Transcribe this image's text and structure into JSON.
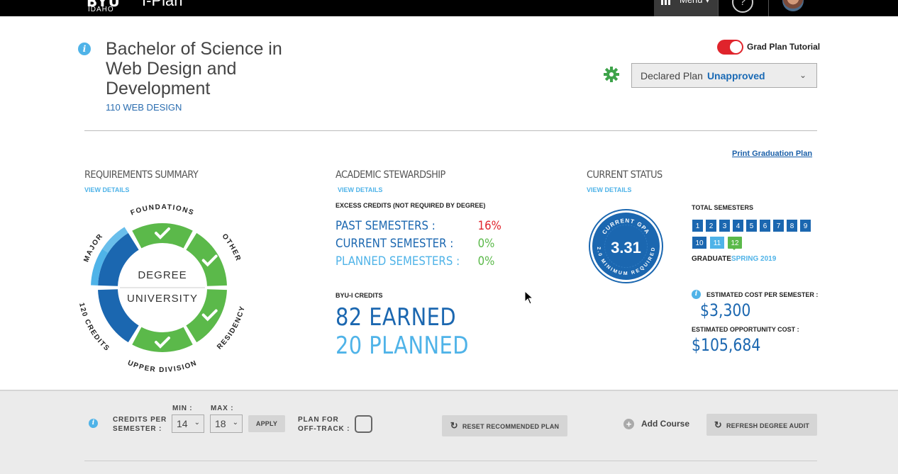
{
  "topbar": {
    "logo": "BYU",
    "logo_sub": "IDAHO",
    "app_name": "I-Plan",
    "menu_label": "Menu ▾",
    "help_label": "?"
  },
  "header": {
    "degree_title": "Bachelor of Science in Web Design and Development",
    "degree_code": "110 WEB DESIGN",
    "tutorial_label": "Grad Plan Tutorial",
    "tutorial_on": true,
    "plan_label": "Declared Plan",
    "plan_status": "Unapproved",
    "print_link": "Print Graduation Plan"
  },
  "requirements": {
    "title": "REQUIREMENTS SUMMARY",
    "view_details": "VIEW DETAILS",
    "center_top": "DEGREE",
    "center_bottom": "UNIVERSITY",
    "segments": [
      {
        "label": "FOUNDATIONS",
        "status": "complete"
      },
      {
        "label": "OTHER",
        "status": "complete"
      },
      {
        "label": "RESIDENCY",
        "status": "complete"
      },
      {
        "label": "UPPER DIVISION",
        "status": "complete"
      },
      {
        "label": "120 CREDITS",
        "status": "in-progress"
      },
      {
        "label": "MAJOR",
        "status": "in-progress"
      }
    ],
    "colors": {
      "complete": "#5bb94a",
      "in_progress": "#1b67b0",
      "planned": "#4fb3e8"
    }
  },
  "stewardship": {
    "title": "ACADEMIC STEWARDSHIP",
    "view_details": "VIEW DETAILS",
    "excess_label": "EXCESS CREDITS (NOT REQUIRED BY DEGREE)",
    "rows": [
      {
        "label": "PAST SEMESTERS :",
        "value": "16%"
      },
      {
        "label": "CURRENT SEMESTER :",
        "value": "0%"
      },
      {
        "label": "PLANNED SEMESTERS :",
        "value": "0%"
      }
    ],
    "credits_label": "BYU-I CREDITS",
    "earned": "82 EARNED",
    "planned": "20 PLANNED"
  },
  "status": {
    "title": "CURRENT STATUS",
    "view_details": "VIEW DETAILS",
    "gpa_top": "CURRENT GPA",
    "gpa": "3.31",
    "gpa_bottom": "(2.0 MINIMUM REQUIRED)",
    "total_semesters_label": "TOTAL SEMESTERS",
    "semesters": [
      "1",
      "2",
      "3",
      "4",
      "5",
      "6",
      "7",
      "8",
      "9",
      "10",
      "11",
      "12"
    ],
    "current_semester": "11",
    "graduate_semester": "12",
    "graduate_label": "GRADUATE",
    "graduate_term": "SPRING 2019",
    "cost_label": "ESTIMATED COST PER SEMESTER :",
    "cost_value": "$3,300",
    "opp_label": "ESTIMATED OPPORTUNITY COST :",
    "opp_value": "$105,684"
  },
  "footer": {
    "credits_label_1": "CREDITS PER",
    "credits_label_2": "SEMESTER :",
    "min_label": "MIN :",
    "min_value": "14",
    "max_label": "MAX :",
    "max_value": "18",
    "apply": "APPLY",
    "offtrack_1": "PLAN FOR",
    "offtrack_2": "OFF-TRACK :",
    "reset": "RESET RECOMMENDED PLAN",
    "add_course": "Add Course",
    "refresh": "REFRESH DEGREE AUDIT"
  }
}
